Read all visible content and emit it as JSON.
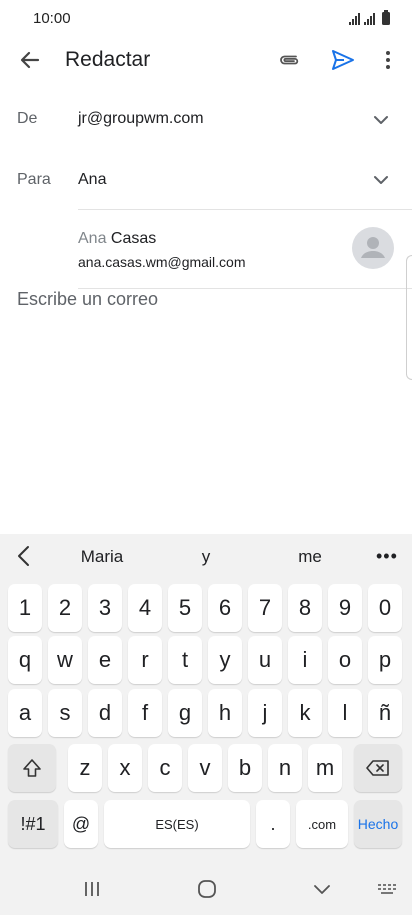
{
  "status": {
    "time": "10:00"
  },
  "appbar": {
    "title": "Redactar",
    "back_icon": "arrow-left-icon",
    "attach_icon": "paperclip-icon",
    "send_icon": "send-icon",
    "more_icon": "more-vert-icon",
    "accent_color": "#1a73e8"
  },
  "from": {
    "label": "De",
    "value": "jr@groupwm.com"
  },
  "to": {
    "label": "Para",
    "value": "Ana"
  },
  "suggestion": {
    "name_match": "Ana",
    "name_rest": " Casas",
    "email": "ana.casas.wm@gmail.com"
  },
  "body": {
    "placeholder": "Escribe un correo"
  },
  "keyboard": {
    "predictions": [
      "Maria",
      "y",
      "me"
    ],
    "more": "•••",
    "numbers": [
      "1",
      "2",
      "3",
      "4",
      "5",
      "6",
      "7",
      "8",
      "9",
      "0"
    ],
    "row1": [
      "q",
      "w",
      "e",
      "r",
      "t",
      "y",
      "u",
      "i",
      "o",
      "p"
    ],
    "row2": [
      "a",
      "s",
      "d",
      "f",
      "g",
      "h",
      "j",
      "k",
      "l",
      "ñ"
    ],
    "row3": [
      "z",
      "x",
      "c",
      "v",
      "b",
      "n",
      "m"
    ],
    "symbols": "!#1",
    "at": "@",
    "space": "ES(ES)",
    "dot": ".",
    "com": ".com",
    "done": "Hecho"
  }
}
